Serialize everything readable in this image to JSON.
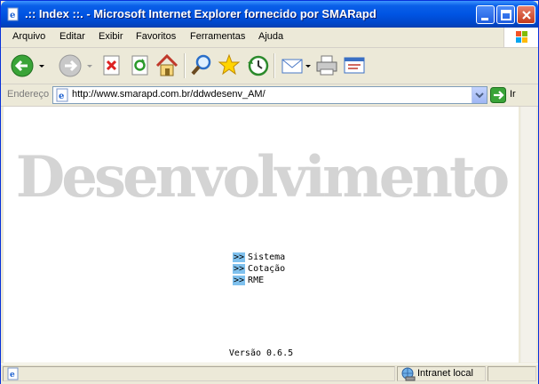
{
  "window": {
    "title": ".:: Index ::. - Microsoft Internet Explorer fornecido por SMARapd"
  },
  "menu": [
    "Arquivo",
    "Editar",
    "Exibir",
    "Favoritos",
    "Ferramentas",
    "Ajuda"
  ],
  "address": {
    "label": "Endereço",
    "url": "http://www.smarapd.com.br/ddwdesenv_AM/",
    "go_label": "Ir"
  },
  "page": {
    "hero": "Desenvolvimento",
    "links": [
      {
        "arrow": ">>",
        "label": "Sistema"
      },
      {
        "arrow": ">>",
        "label": "Cotação"
      },
      {
        "arrow": ">>",
        "label": "RME"
      }
    ],
    "version": "Versão 0.6.5"
  },
  "status": {
    "zone": "Intranet local"
  }
}
